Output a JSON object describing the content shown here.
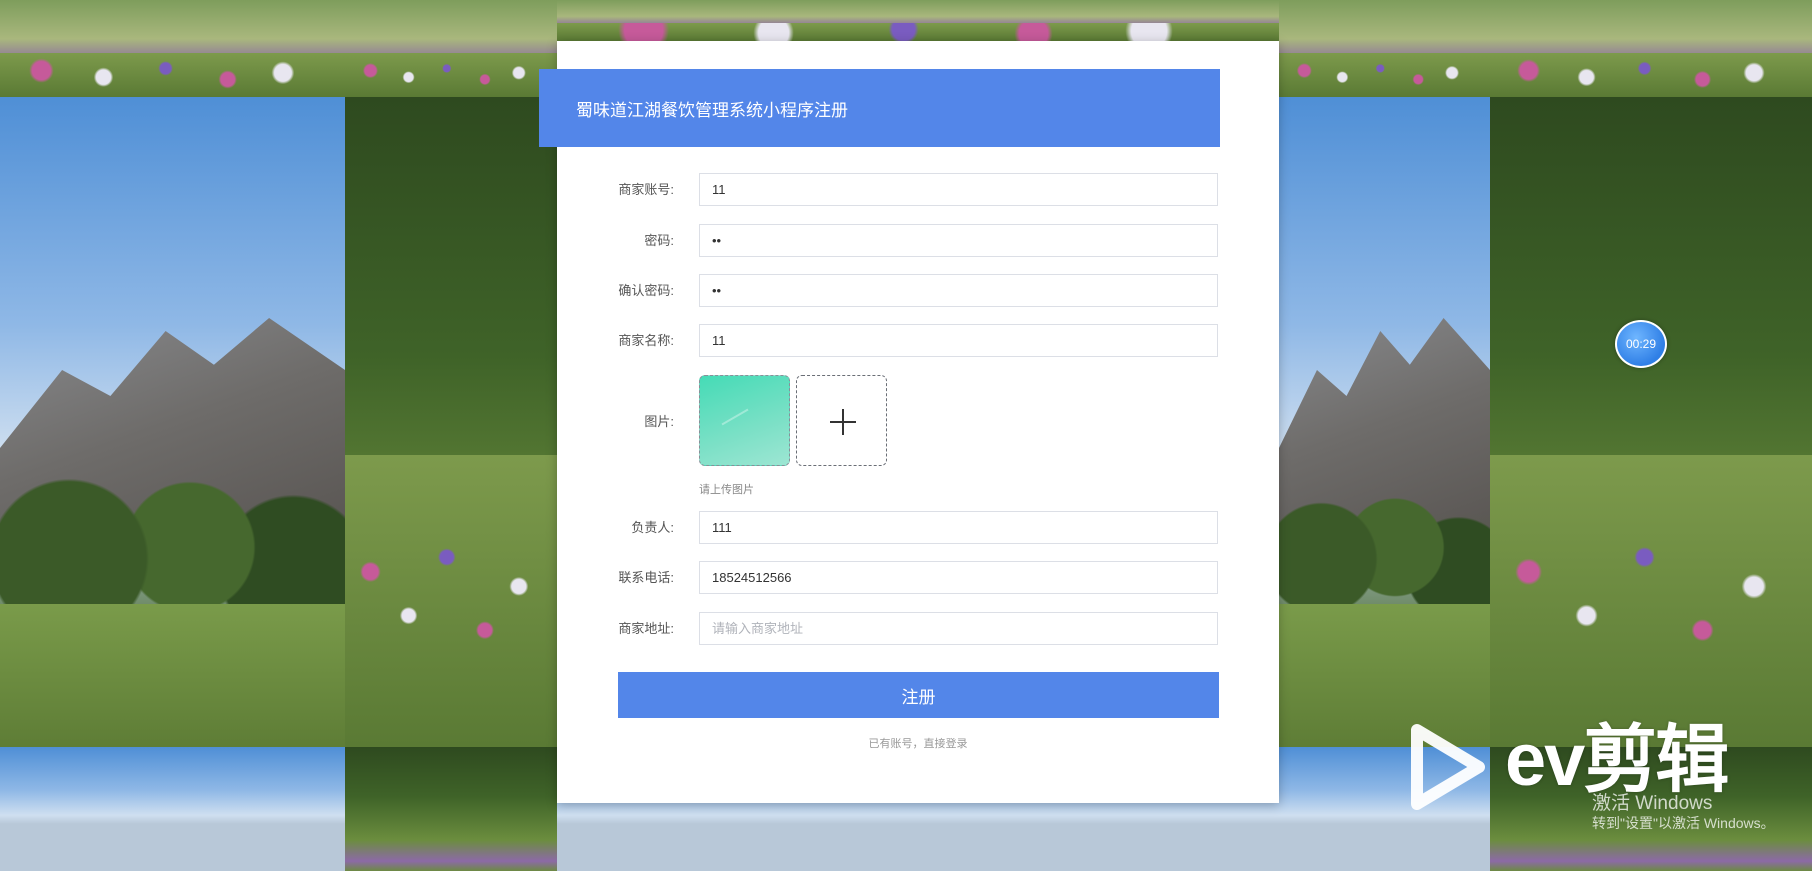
{
  "header": {
    "title": "蜀味道江湖餐饮管理系统小程序注册"
  },
  "form": {
    "account": {
      "label": "商家账号:",
      "value": "11"
    },
    "password": {
      "label": "密码:",
      "value": "••"
    },
    "confirm_password": {
      "label": "确认密码:",
      "value": "••"
    },
    "merchant_name": {
      "label": "商家名称:",
      "value": "11"
    },
    "image": {
      "label": "图片:",
      "hint": "请上传图片"
    },
    "person_in_charge": {
      "label": "负责人:",
      "value": "111"
    },
    "phone": {
      "label": "联系电话:",
      "value": "18524512566"
    },
    "address": {
      "label": "商家地址:",
      "placeholder": "请输入商家地址"
    }
  },
  "actions": {
    "submit_label": "注册",
    "login_link": "已有账号，直接登录"
  },
  "overlay": {
    "timer": "00:29",
    "watermark": "ev剪辑",
    "activate_title": "激活 Windows",
    "activate_sub": "转到\"设置\"以激活 Windows。"
  },
  "colors": {
    "primary": "#5386e9",
    "thumbnail": "#45dbb6"
  }
}
